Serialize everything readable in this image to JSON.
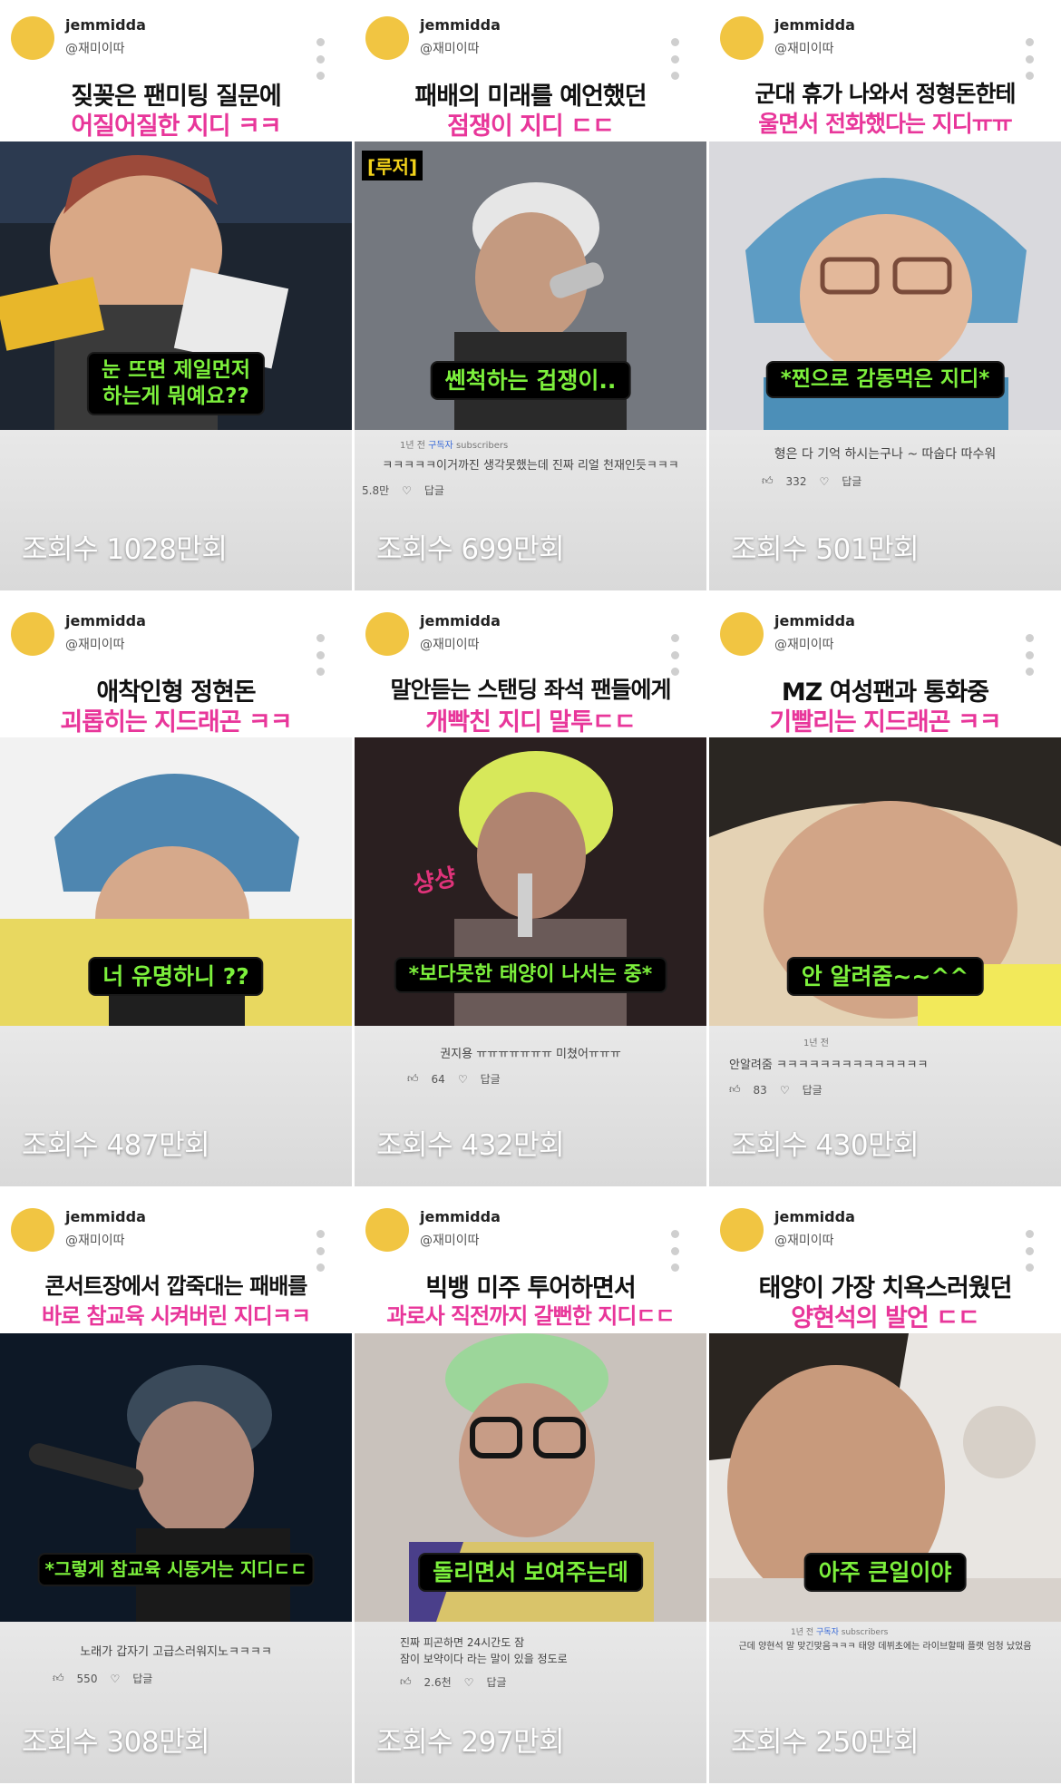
{
  "channel": {
    "username": "jemmidda",
    "handle": "@재미이따"
  },
  "tiles": [
    {
      "title_line1": "짖꽂은 팬미팅 질문에",
      "title_line2": "어질어질한 지디 ㅋㅋ",
      "caption": "눈 뜨면 제일먼저\n하는게 뭐예요??",
      "views": "조회수 1028만회"
    },
    {
      "title_line1": "패배의 미래를 예언했던",
      "title_line2": "점쟁이 지디 ㄷㄷ",
      "tag": "[루저]",
      "caption": "쎈척하는 겁쟁이..",
      "comment_meta": "1년 전",
      "comment_badge": "구독자",
      "comment_sub": "subscribers",
      "comment_text": "ㅋㅋㅋㅋㅋ이거까진 생각못했는데 진짜 리얼 천재인듯ㅋㅋㅋ",
      "comment_likes": "5.8만",
      "comment_reply": "답글",
      "views": "조회수 699만회"
    },
    {
      "title_line1": "군대 휴가 나와서 정형돈한테",
      "title_line2": "울면서 전화했다는 지디ㅠㅠ",
      "caption": "*찐으로 감동먹은 지디*",
      "comment_text": "형은 다 기억 하시는구나 ~ 따숩다 따수워",
      "comment_likes": "332",
      "comment_reply": "답글",
      "views": "조회수 501만회"
    },
    {
      "title_line1": "애착인형 정현돈",
      "title_line2": "괴롭히는 지드래곤 ㅋㅋ",
      "caption": "너 유명하니 ??",
      "views": "조회수 487만회"
    },
    {
      "title_line1": "말안듣는 스탠딩 좌석 팬들에게",
      "title_line2": "개빡친 지디 말투ㄷㄷ",
      "scribble": "샹샹",
      "caption": "*보다못한 태양이 나서는 중*",
      "comment_text": "권지용 ㅠㅠㅠㅠㅠㅠㅠ 미쳤어ㅠㅠㅠ",
      "comment_likes": "64",
      "comment_reply": "답글",
      "views": "조회수 432만회"
    },
    {
      "title_line1": "MZ 여성팬과 통화중",
      "title_line2": "기빨리는 지드래곤 ㅋㅋ",
      "caption": "안 알려줌~~^^",
      "comment_meta": "1년 전",
      "comment_text": "안알려줌 ㅋㅋㅋㅋㅋㅋㅋㅋㅋㅋㅋㅋㅋㅋ",
      "comment_likes": "83",
      "comment_reply": "답글",
      "views": "조회수 430만회"
    },
    {
      "title_line1": "콘서트장에서 깝죽대는 패배를",
      "title_line2": "바로 참교육 시켜버린 지디ㅋㅋ",
      "caption": "*그렇게 참교육 시동거는 지디ㄷㄷ",
      "comment_text": "노래가 갑자기 고급스러워지노ㅋㅋㅋㅋ",
      "comment_likes": "550",
      "comment_reply": "답글",
      "views": "조회수 308만회"
    },
    {
      "title_line1": "빅뱅 미주 투어하면서",
      "title_line2": "과로사 직전까지 갈뻔한 지디ㄷㄷ",
      "caption": "돌리면서 보여주는데",
      "comment_text": "진짜 피곤하면 24시간도 잠\n잠이 보약이다 라는 말이 있을 정도로",
      "comment_likes": "2.6천",
      "comment_reply": "답글",
      "views": "조회수 297만회"
    },
    {
      "title_line1": "태양이 가장 치욕스러웠던",
      "title_line2": "양현석의 발언 ㄷㄷ",
      "caption": "아주 큰일이야",
      "comment_meta": "1년 전",
      "comment_badge": "구독자",
      "comment_sub": "subscribers",
      "comment_text": "근데 양현석 말 맞긴맞음ㅋㅋㅋ 태양 데뷔초에는 라이브할때 플랫 엄청 났었음",
      "views": "조회수 250만회"
    }
  ]
}
